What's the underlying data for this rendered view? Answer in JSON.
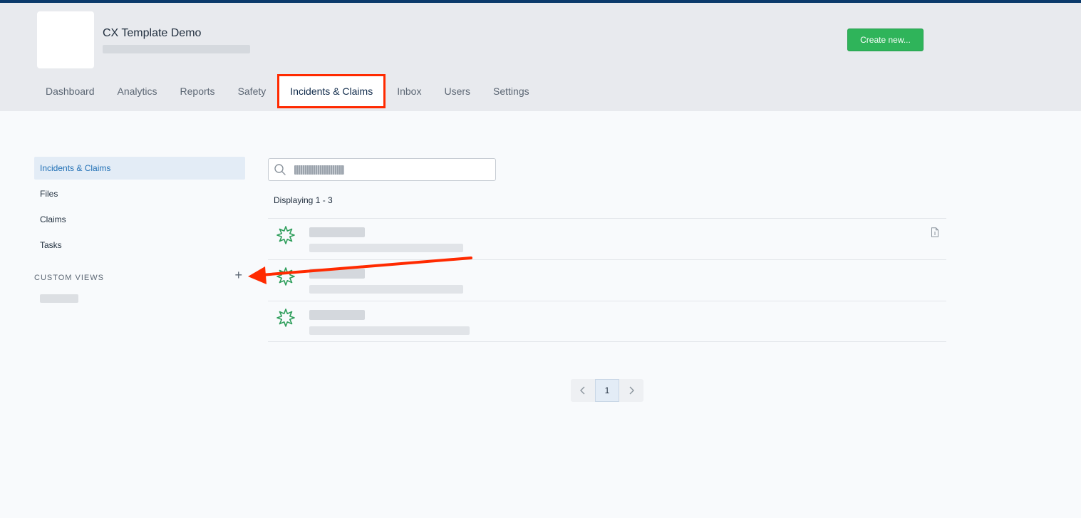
{
  "header": {
    "org_title": "CX Template Demo",
    "create_button": "Create new..."
  },
  "nav": {
    "tabs": [
      {
        "label": "Dashboard"
      },
      {
        "label": "Analytics"
      },
      {
        "label": "Reports"
      },
      {
        "label": "Safety"
      },
      {
        "label": "Incidents & Claims",
        "active": true
      },
      {
        "label": "Inbox"
      },
      {
        "label": "Users"
      },
      {
        "label": "Settings"
      }
    ]
  },
  "sidebar": {
    "items": [
      {
        "label": "Incidents & Claims",
        "active": true
      },
      {
        "label": "Files"
      },
      {
        "label": "Claims"
      },
      {
        "label": "Tasks"
      }
    ],
    "custom_views_label": "CUSTOM VIEWS",
    "add_icon": "plus-icon"
  },
  "main": {
    "search": {
      "placeholder": "",
      "icon": "search-icon"
    },
    "display_count": "Displaying 1 - 3",
    "rows": [
      {
        "icon": "burst-icon",
        "has_document": true
      },
      {
        "icon": "burst-icon",
        "has_document": false
      },
      {
        "icon": "burst-icon",
        "has_document": false
      }
    ]
  },
  "pagination": {
    "prev_icon": "chevron-left-icon",
    "current_page": "1",
    "next_icon": "chevron-right-icon"
  },
  "colors": {
    "accent_blue": "#1f6fb5",
    "create_green": "#2fb45a",
    "highlight_red": "#ff2a00",
    "icon_green": "#2e9e5b"
  }
}
